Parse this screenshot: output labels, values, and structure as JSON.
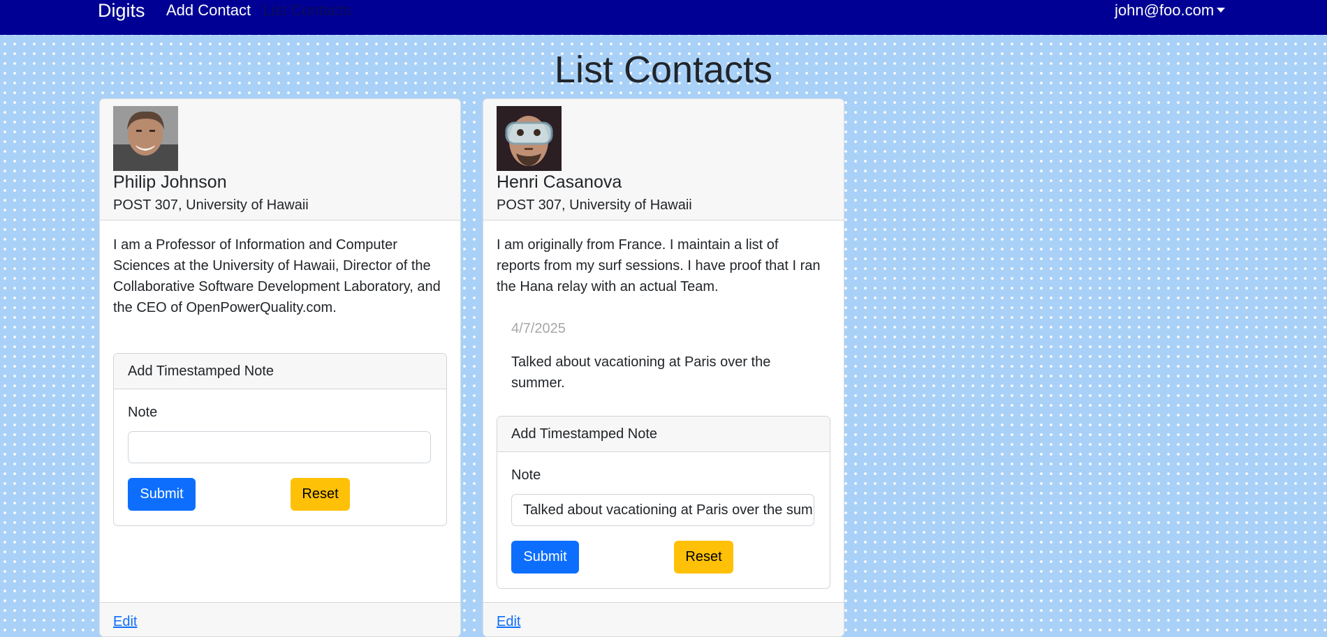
{
  "navbar": {
    "brand": "Digits",
    "links": [
      {
        "label": "Add Contact"
      },
      {
        "label": "List Contacts"
      }
    ],
    "user": "john@foo.com",
    "user_icon": "caret-down-icon",
    "bg_color": "#000094"
  },
  "page": {
    "title": "List Contacts"
  },
  "contacts": [
    {
      "name": "Philip Johnson",
      "address": "POST 307, University of Hawaii",
      "description": "I am a Professor of Information and Computer Sciences at the University of Hawaii, Director of the Collaborative Software Development Laboratory, and the CEO of OpenPowerQuality.com.",
      "notes": [],
      "form": {
        "title": "Add Timestamped Note",
        "label": "Note",
        "value": "",
        "submit": "Submit",
        "reset": "Reset"
      },
      "edit": "Edit"
    },
    {
      "name": "Henri Casanova",
      "address": "POST 307, University of Hawaii",
      "description": "I am originally from France. I maintain a list of reports from my surf sessions. I have proof that I ran the Hana relay with an actual Team.",
      "notes": [
        {
          "date": "4/7/2025",
          "text": "Talked about vacationing at Paris over the summer."
        }
      ],
      "form": {
        "title": "Add Timestamped Note",
        "label": "Note",
        "value": "Talked about vacationing at Paris over the summer.",
        "submit": "Submit",
        "reset": "Reset"
      },
      "edit": "Edit"
    }
  ],
  "colors": {
    "primary": "#0d6efd",
    "warning": "#ffc107",
    "background": "#a9d1f8"
  }
}
